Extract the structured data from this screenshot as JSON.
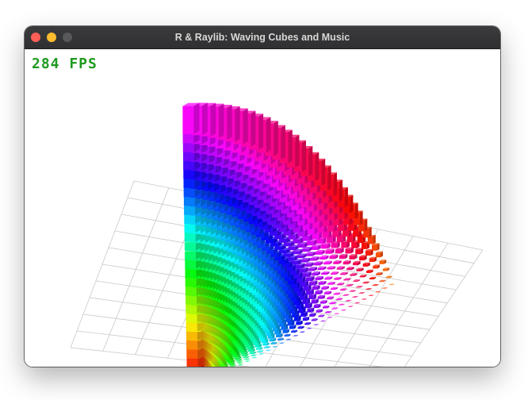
{
  "window": {
    "title": "R & Raylib: Waving Cubes and Music",
    "traffic_lights": {
      "close": "close-icon",
      "minimize": "minimize-icon",
      "zoom": "zoom-icon"
    }
  },
  "viewport": {
    "fps_text": "284 FPS",
    "fps_color": "#1f9a1f",
    "background": "#ffffff",
    "grid_color": "#c8c8c8"
  }
}
